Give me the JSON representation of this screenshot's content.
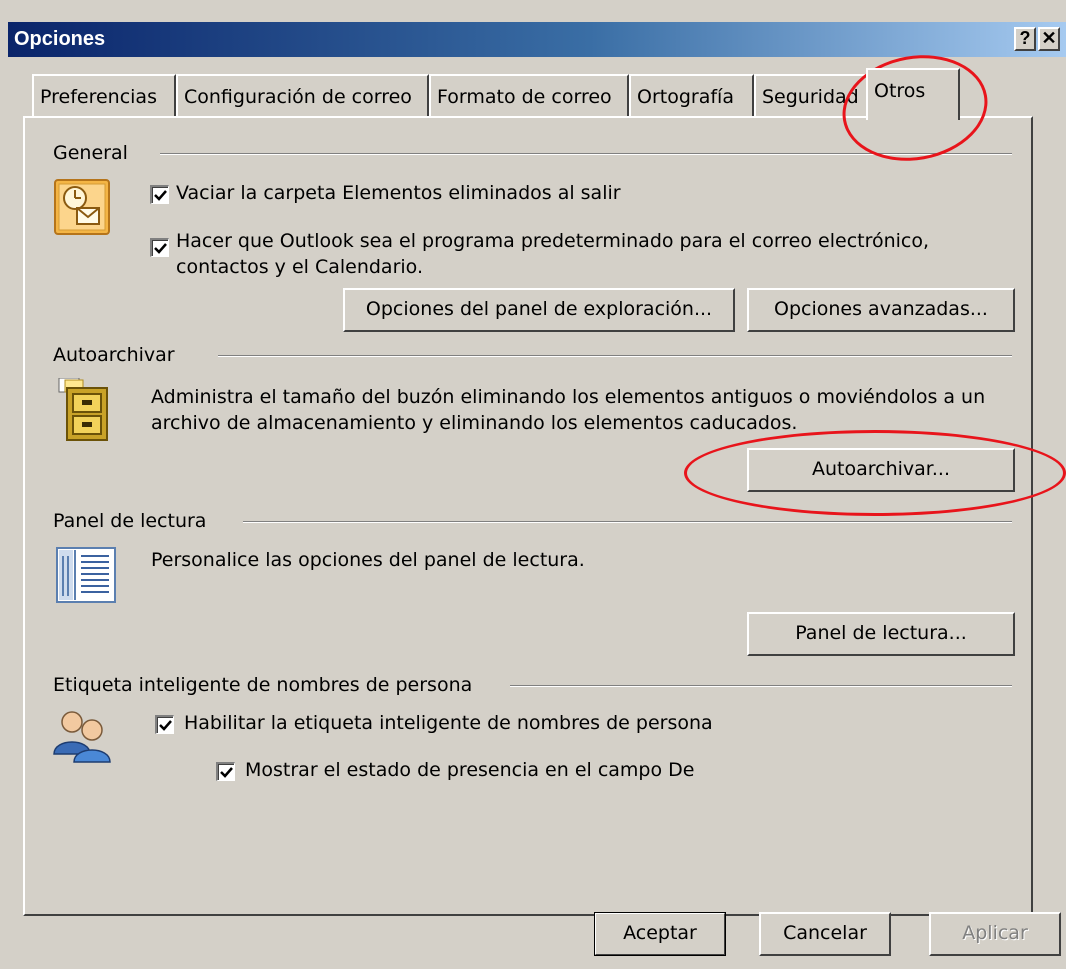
{
  "window": {
    "title": "Opciones",
    "help_label": "?",
    "close_label": "✕"
  },
  "tabs": [
    {
      "label": "Preferencias"
    },
    {
      "label": "Configuración de correo"
    },
    {
      "label": "Formato de correo"
    },
    {
      "label": "Ortografía"
    },
    {
      "label": "Seguridad"
    },
    {
      "label": "Otros",
      "active": true
    }
  ],
  "general": {
    "title": "General",
    "checkbox1": {
      "label": "Vaciar la carpeta Elementos eliminados al salir",
      "checked": true
    },
    "checkbox2": {
      "label_line1": "Hacer que Outlook sea el programa predeterminado para el correo electrónico,",
      "label_line2": "contactos y el Calendario.",
      "checked": true
    },
    "nav_pane_button": "Opciones del panel de exploración...",
    "advanced_button": "Opciones avanzadas..."
  },
  "autoarchive": {
    "title": "Autoarchivar",
    "description_line1": "Administra el tamaño del buzón eliminando los elementos antiguos o moviéndolos a un",
    "description_line2": "archivo de almacenamiento y eliminando los elementos caducados.",
    "button": "Autoarchivar..."
  },
  "reading_pane": {
    "title": "Panel de lectura",
    "description": "Personalice las opciones del panel de lectura.",
    "button": "Panel de lectura..."
  },
  "smart_tag": {
    "title": "Etiqueta inteligente de nombres de persona",
    "checkbox1": {
      "label": "Habilitar la etiqueta inteligente de nombres de persona",
      "checked": true
    },
    "checkbox2": {
      "label": "Mostrar el estado de presencia en el campo De",
      "checked": true
    }
  },
  "footer": {
    "ok": "Aceptar",
    "cancel": "Cancelar",
    "apply": "Aplicar"
  },
  "colors": {
    "face": "#d4d0c8",
    "title_dark": "#0a246a",
    "title_light": "#a6caf0",
    "annotation": "#e8141b"
  },
  "icons": [
    "outlook-clock-icon",
    "archive-cabinet-icon",
    "reading-pane-icon",
    "persons-icon",
    "checkmark-icon"
  ]
}
